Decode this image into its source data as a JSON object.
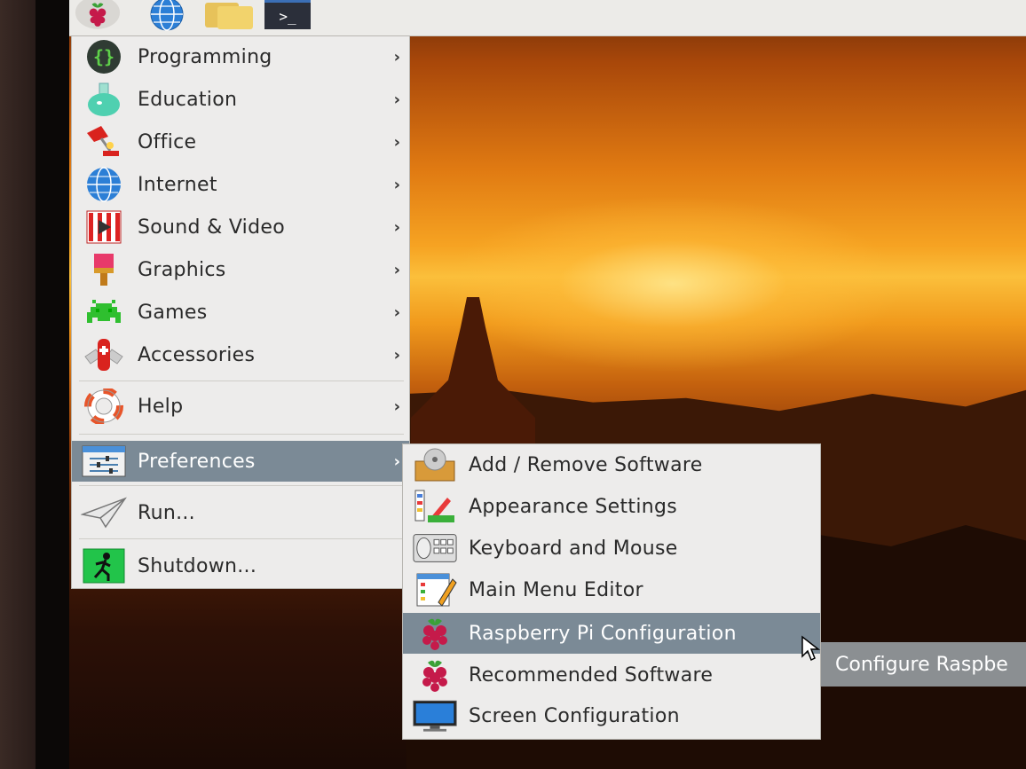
{
  "panel": {
    "icons": [
      "raspberry-pi-menu-icon",
      "web-browser-icon",
      "file-manager-icon",
      "terminal-icon"
    ],
    "terminal_glyph": ">_"
  },
  "menu": {
    "items": [
      {
        "label": "Programming",
        "icon": "programming-icon",
        "has_submenu": true
      },
      {
        "label": "Education",
        "icon": "education-icon",
        "has_submenu": true
      },
      {
        "label": "Office",
        "icon": "office-icon",
        "has_submenu": true
      },
      {
        "label": "Internet",
        "icon": "internet-icon",
        "has_submenu": true
      },
      {
        "label": "Sound & Video",
        "icon": "sound-video-icon",
        "has_submenu": true
      },
      {
        "label": "Graphics",
        "icon": "graphics-icon",
        "has_submenu": true
      },
      {
        "label": "Games",
        "icon": "games-icon",
        "has_submenu": true
      },
      {
        "label": "Accessories",
        "icon": "accessories-icon",
        "has_submenu": true
      },
      {
        "label": "Help",
        "icon": "help-icon",
        "has_submenu": true
      },
      {
        "label": "Preferences",
        "icon": "preferences-icon",
        "has_submenu": true,
        "active": true
      },
      {
        "label": "Run...",
        "icon": "run-icon",
        "has_submenu": false
      },
      {
        "label": "Shutdown...",
        "icon": "shutdown-icon",
        "has_submenu": false
      }
    ],
    "arrow": "›"
  },
  "submenu": {
    "items": [
      {
        "label": "Add / Remove Software",
        "icon": "add-remove-software-icon"
      },
      {
        "label": "Appearance Settings",
        "icon": "appearance-settings-icon"
      },
      {
        "label": "Keyboard and Mouse",
        "icon": "keyboard-mouse-icon"
      },
      {
        "label": "Main Menu Editor",
        "icon": "main-menu-editor-icon"
      },
      {
        "label": "Raspberry Pi Configuration",
        "icon": "raspberry-pi-icon",
        "active": true
      },
      {
        "label": "Recommended Software",
        "icon": "raspberry-pi-icon"
      },
      {
        "label": "Screen Configuration",
        "icon": "monitor-icon"
      }
    ]
  },
  "tooltip": {
    "text": "Configure Raspbe"
  },
  "colors": {
    "highlight": "#7b8a96",
    "menu_bg": "#edeceb",
    "panel_bg": "#ecebe8"
  }
}
